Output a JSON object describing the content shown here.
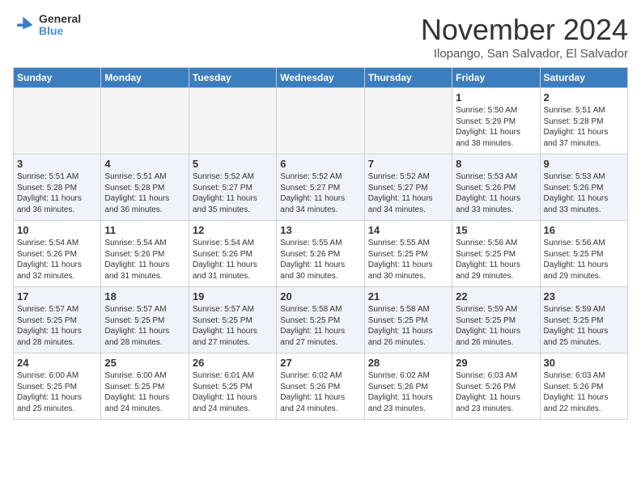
{
  "header": {
    "logo_general": "General",
    "logo_blue": "Blue",
    "month_title": "November 2024",
    "location": "Ilopango, San Salvador, El Salvador"
  },
  "days_of_week": [
    "Sunday",
    "Monday",
    "Tuesday",
    "Wednesday",
    "Thursday",
    "Friday",
    "Saturday"
  ],
  "weeks": [
    {
      "alt": false,
      "days": [
        {
          "num": "",
          "info": ""
        },
        {
          "num": "",
          "info": ""
        },
        {
          "num": "",
          "info": ""
        },
        {
          "num": "",
          "info": ""
        },
        {
          "num": "",
          "info": ""
        },
        {
          "num": "1",
          "info": "Sunrise: 5:50 AM\nSunset: 5:29 PM\nDaylight: 11 hours\nand 38 minutes."
        },
        {
          "num": "2",
          "info": "Sunrise: 5:51 AM\nSunset: 5:28 PM\nDaylight: 11 hours\nand 37 minutes."
        }
      ]
    },
    {
      "alt": true,
      "days": [
        {
          "num": "3",
          "info": "Sunrise: 5:51 AM\nSunset: 5:28 PM\nDaylight: 11 hours\nand 36 minutes."
        },
        {
          "num": "4",
          "info": "Sunrise: 5:51 AM\nSunset: 5:28 PM\nDaylight: 11 hours\nand 36 minutes."
        },
        {
          "num": "5",
          "info": "Sunrise: 5:52 AM\nSunset: 5:27 PM\nDaylight: 11 hours\nand 35 minutes."
        },
        {
          "num": "6",
          "info": "Sunrise: 5:52 AM\nSunset: 5:27 PM\nDaylight: 11 hours\nand 34 minutes."
        },
        {
          "num": "7",
          "info": "Sunrise: 5:52 AM\nSunset: 5:27 PM\nDaylight: 11 hours\nand 34 minutes."
        },
        {
          "num": "8",
          "info": "Sunrise: 5:53 AM\nSunset: 5:26 PM\nDaylight: 11 hours\nand 33 minutes."
        },
        {
          "num": "9",
          "info": "Sunrise: 5:53 AM\nSunset: 5:26 PM\nDaylight: 11 hours\nand 33 minutes."
        }
      ]
    },
    {
      "alt": false,
      "days": [
        {
          "num": "10",
          "info": "Sunrise: 5:54 AM\nSunset: 5:26 PM\nDaylight: 11 hours\nand 32 minutes."
        },
        {
          "num": "11",
          "info": "Sunrise: 5:54 AM\nSunset: 5:26 PM\nDaylight: 11 hours\nand 31 minutes."
        },
        {
          "num": "12",
          "info": "Sunrise: 5:54 AM\nSunset: 5:26 PM\nDaylight: 11 hours\nand 31 minutes."
        },
        {
          "num": "13",
          "info": "Sunrise: 5:55 AM\nSunset: 5:26 PM\nDaylight: 11 hours\nand 30 minutes."
        },
        {
          "num": "14",
          "info": "Sunrise: 5:55 AM\nSunset: 5:25 PM\nDaylight: 11 hours\nand 30 minutes."
        },
        {
          "num": "15",
          "info": "Sunrise: 5:56 AM\nSunset: 5:25 PM\nDaylight: 11 hours\nand 29 minutes."
        },
        {
          "num": "16",
          "info": "Sunrise: 5:56 AM\nSunset: 5:25 PM\nDaylight: 11 hours\nand 29 minutes."
        }
      ]
    },
    {
      "alt": true,
      "days": [
        {
          "num": "17",
          "info": "Sunrise: 5:57 AM\nSunset: 5:25 PM\nDaylight: 11 hours\nand 28 minutes."
        },
        {
          "num": "18",
          "info": "Sunrise: 5:57 AM\nSunset: 5:25 PM\nDaylight: 11 hours\nand 28 minutes."
        },
        {
          "num": "19",
          "info": "Sunrise: 5:57 AM\nSunset: 5:25 PM\nDaylight: 11 hours\nand 27 minutes."
        },
        {
          "num": "20",
          "info": "Sunrise: 5:58 AM\nSunset: 5:25 PM\nDaylight: 11 hours\nand 27 minutes."
        },
        {
          "num": "21",
          "info": "Sunrise: 5:58 AM\nSunset: 5:25 PM\nDaylight: 11 hours\nand 26 minutes."
        },
        {
          "num": "22",
          "info": "Sunrise: 5:59 AM\nSunset: 5:25 PM\nDaylight: 11 hours\nand 26 minutes."
        },
        {
          "num": "23",
          "info": "Sunrise: 5:59 AM\nSunset: 5:25 PM\nDaylight: 11 hours\nand 25 minutes."
        }
      ]
    },
    {
      "alt": false,
      "days": [
        {
          "num": "24",
          "info": "Sunrise: 6:00 AM\nSunset: 5:25 PM\nDaylight: 11 hours\nand 25 minutes."
        },
        {
          "num": "25",
          "info": "Sunrise: 6:00 AM\nSunset: 5:25 PM\nDaylight: 11 hours\nand 24 minutes."
        },
        {
          "num": "26",
          "info": "Sunrise: 6:01 AM\nSunset: 5:25 PM\nDaylight: 11 hours\nand 24 minutes."
        },
        {
          "num": "27",
          "info": "Sunrise: 6:02 AM\nSunset: 5:26 PM\nDaylight: 11 hours\nand 24 minutes."
        },
        {
          "num": "28",
          "info": "Sunrise: 6:02 AM\nSunset: 5:26 PM\nDaylight: 11 hours\nand 23 minutes."
        },
        {
          "num": "29",
          "info": "Sunrise: 6:03 AM\nSunset: 5:26 PM\nDaylight: 11 hours\nand 23 minutes."
        },
        {
          "num": "30",
          "info": "Sunrise: 6:03 AM\nSunset: 5:26 PM\nDaylight: 11 hours\nand 22 minutes."
        }
      ]
    }
  ]
}
